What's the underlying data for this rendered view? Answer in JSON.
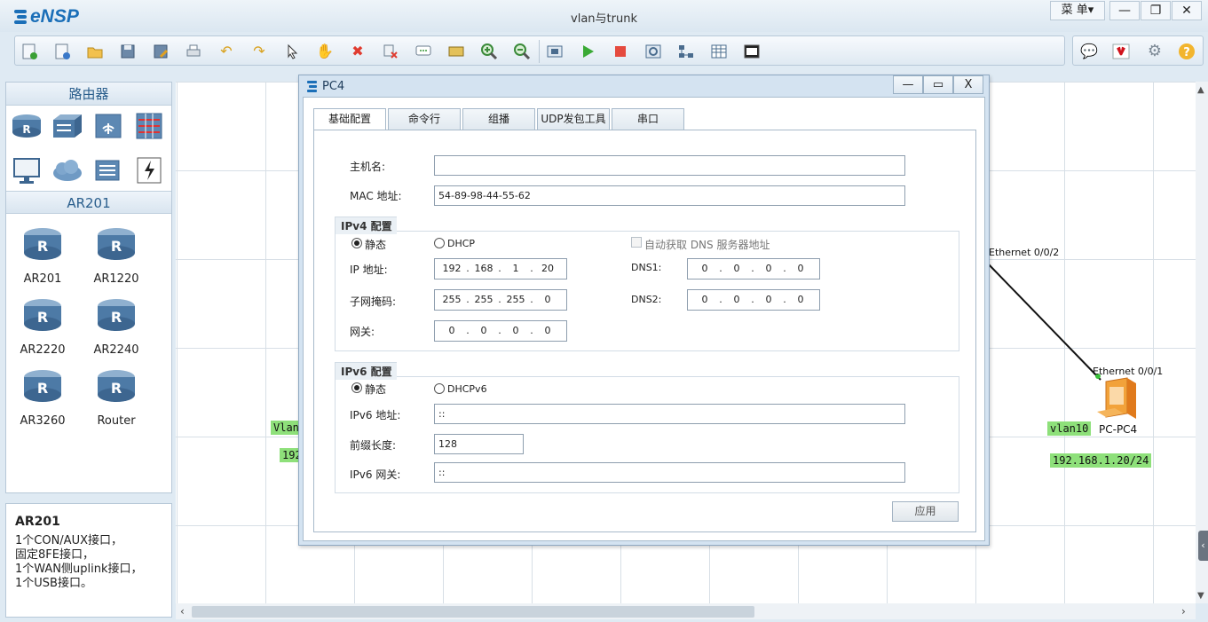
{
  "app": {
    "logo_text": "eNSP",
    "window_title": "vlan与trunk",
    "menu_label": "菜 单▾",
    "minimize": "—",
    "restore": "❐",
    "close": "✕"
  },
  "toolbar": {
    "icons": [
      "new-topology-icon",
      "new-lab-icon",
      "open-icon",
      "save-icon",
      "save-as-icon",
      "print-icon",
      "undo-icon",
      "redo-icon",
      "select-icon",
      "pan-hand-icon",
      "delete-icon",
      "delete-link-icon",
      "text-icon",
      "palette-icon",
      "zoom-in-icon",
      "zoom-out-icon",
      "fit-icon",
      "start-icon",
      "stop-icon",
      "capture-icon",
      "topology-icon",
      "grid-icon",
      "console-icon"
    ],
    "right_icons": [
      "chat-icon",
      "huawei-icon",
      "settings-icon",
      "help-icon"
    ]
  },
  "left_panel": {
    "section_title": "路由器",
    "device_group_title": "AR201",
    "devices": [
      {
        "label": "AR201"
      },
      {
        "label": "AR1220"
      },
      {
        "label": "AR2220"
      },
      {
        "label": "AR2240"
      },
      {
        "label": "AR3260"
      },
      {
        "label": "Router"
      }
    ]
  },
  "info_panel": {
    "title": "AR201",
    "lines": [
      "1个CON/AUX接口，",
      "固定8FE接口，",
      "1个WAN侧uplink接口，",
      "1个USB接口。"
    ]
  },
  "canvas": {
    "port_top": "Ethernet 0/0/2",
    "port_bottom": "Ethernet 0/0/1",
    "pc_label": "PC-PC4",
    "vlan_tag": "vlan10",
    "ip_tag": "192.168.1.20/24",
    "left_vlan_tag": "Vlan",
    "left_ip_tag": "192."
  },
  "dialog": {
    "title": "PC4",
    "tabs": [
      "基础配置",
      "命令行",
      "组播",
      "UDP发包工具",
      "串口"
    ],
    "hostname_label": "主机名:",
    "hostname_value": "",
    "mac_label": "MAC 地址:",
    "mac_value": "54-89-98-44-55-62",
    "ipv4_group": "IPv4 配置",
    "static_label": "静态",
    "dhcp_label": "DHCP",
    "auto_dns_label": "自动获取 DNS 服务器地址",
    "ip_label": "IP 地址:",
    "ip_value": [
      "192",
      "168",
      "1",
      "20"
    ],
    "mask_label": "子网掩码:",
    "mask_value": [
      "255",
      "255",
      "255",
      "0"
    ],
    "gateway_label": "网关:",
    "gateway_value": [
      "0",
      "0",
      "0",
      "0"
    ],
    "dns1_label": "DNS1:",
    "dns1_value": [
      "0",
      "0",
      "0",
      "0"
    ],
    "dns2_label": "DNS2:",
    "dns2_value": [
      "0",
      "0",
      "0",
      "0"
    ],
    "ipv6_group": "IPv6 配置",
    "static6_label": "静态",
    "dhcpv6_label": "DHCPv6",
    "ipv6_addr_label": "IPv6 地址:",
    "ipv6_addr_value": "::",
    "prefix_label": "前缀长度:",
    "prefix_value": "128",
    "ipv6_gw_label": "IPv6 网关:",
    "ipv6_gw_value": "::",
    "apply_label": "应用"
  }
}
